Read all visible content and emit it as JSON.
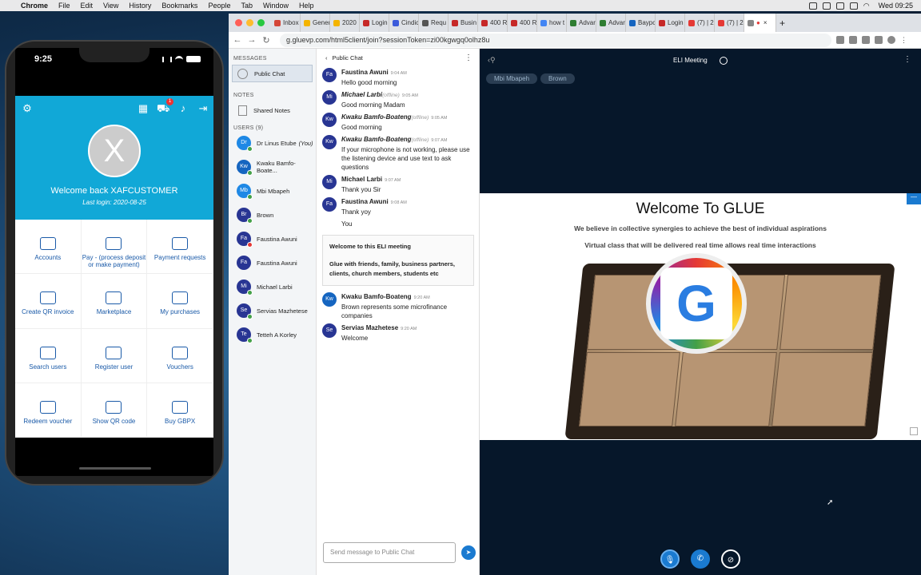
{
  "menubar": {
    "app": "Chrome",
    "items": [
      "File",
      "Edit",
      "View",
      "History",
      "Bookmarks",
      "People",
      "Tab",
      "Window",
      "Help"
    ],
    "clock": "Wed 09:25"
  },
  "phone": {
    "time": "9:25",
    "cart_badge": "1",
    "avatar_letter": "X",
    "welcome": "Welcome back XAFCUSTOMER",
    "last_login": "Last login: 2020-08-25",
    "grid": [
      "Accounts",
      "Pay - (process deposit or make payment)",
      "Payment requests",
      "Create QR invoice",
      "Marketplace",
      "My purchases",
      "Search users",
      "Register user",
      "Vouchers",
      "Redeem voucher",
      "Show QR code",
      "Buy GBPX"
    ]
  },
  "browser": {
    "tabs": [
      {
        "label": "Inbox",
        "color": "#d44638"
      },
      {
        "label": "Gener",
        "color": "#f4b400"
      },
      {
        "label": "2020",
        "color": "#f4b400"
      },
      {
        "label": "Login",
        "color": "#c62828"
      },
      {
        "label": "Cindic",
        "color": "#3b5bdb"
      },
      {
        "label": "Requ",
        "color": "#555"
      },
      {
        "label": "Busin",
        "color": "#c62828"
      },
      {
        "label": "400 R",
        "color": "#c62828"
      },
      {
        "label": "400 R",
        "color": "#c62828"
      },
      {
        "label": "how t",
        "color": "#4285f4"
      },
      {
        "label": "Advar",
        "color": "#2e7d32"
      },
      {
        "label": "Advar",
        "color": "#2e7d32"
      },
      {
        "label": "Baypc",
        "color": "#1565c0"
      },
      {
        "label": "Login",
        "color": "#c62828"
      },
      {
        "label": "(7) | 2",
        "color": "#e53935"
      },
      {
        "label": "(7) | 2",
        "color": "#e53935"
      }
    ],
    "url": "g.gluevp.com/html5client/join?sessionToken=zi00kgwgq0olhz8u"
  },
  "sidebar": {
    "messages_title": "MESSAGES",
    "public_chat": "Public Chat",
    "notes_title": "NOTES",
    "shared_notes": "Shared Notes",
    "users_title": "USERS (9)",
    "users": [
      {
        "initials": "Dr",
        "name": "Dr Linus Etube",
        "suffix": "(You)",
        "color": "#1e88e5",
        "status": "#43a047"
      },
      {
        "initials": "Kw",
        "name": "Kwaku Bamfo-Boate...",
        "suffix": "",
        "color": "#1565c0",
        "status": "#43a047"
      },
      {
        "initials": "Mb",
        "name": "Mbi Mbapeh",
        "suffix": "",
        "color": "#1e88e5",
        "status": "#43a047"
      },
      {
        "initials": "Br",
        "name": "Brown",
        "suffix": "",
        "color": "#283593",
        "status": "#43a047"
      },
      {
        "initials": "Fa",
        "name": "Faustina Awuni",
        "suffix": "",
        "color": "#283593",
        "status": "#e53935"
      },
      {
        "initials": "Fa",
        "name": "Faustina Awuni",
        "suffix": "",
        "color": "#283593",
        "status": ""
      },
      {
        "initials": "Mi",
        "name": "Michael Larbi",
        "suffix": "",
        "color": "#283593",
        "status": "#43a047"
      },
      {
        "initials": "Se",
        "name": "Servias Mazhetese",
        "suffix": "",
        "color": "#283593",
        "status": "#43a047"
      },
      {
        "initials": "Te",
        "name": "Tetteh A Korley",
        "suffix": "",
        "color": "#283593",
        "status": "#43a047"
      }
    ]
  },
  "chat": {
    "title": "Public Chat",
    "messages": [
      {
        "initials": "Fa",
        "name": "Faustina Awuni",
        "offline": "",
        "time": "9:04 AM",
        "lines": [
          "Hello good morning"
        ],
        "color": "#283593",
        "italic": false
      },
      {
        "initials": "Mi",
        "name": "Michael Larbi",
        "offline": "(offline)",
        "time": "9:05 AM",
        "lines": [
          "Good morning Madam"
        ],
        "color": "#283593",
        "italic": true
      },
      {
        "initials": "Kw",
        "name": "Kwaku Bamfo-Boateng",
        "offline": "(offline)",
        "time": "9:05 AM",
        "lines": [
          "Good morning"
        ],
        "color": "#283593",
        "italic": true
      },
      {
        "initials": "Kw",
        "name": "Kwaku Bamfo-Boateng",
        "offline": "(offline)",
        "time": "9:07 AM",
        "lines": [
          "If your microphone is not working, please use the listening device and use text to ask questions"
        ],
        "color": "#283593",
        "italic": true
      },
      {
        "initials": "Mi",
        "name": "Michael Larbi",
        "offline": "",
        "time": "9:07 AM",
        "lines": [
          "Thank you Sir"
        ],
        "color": "#283593",
        "italic": false
      },
      {
        "initials": "Fa",
        "name": "Faustina Awuni",
        "offline": "",
        "time": "9:08 AM",
        "lines": [
          "Thank yoy",
          "You"
        ],
        "color": "#283593",
        "italic": false
      }
    ],
    "welcome_title": "Welcome to this ELI meeting",
    "welcome_body": "Glue with friends, family, business partners, clients, church members, students etc",
    "messages2": [
      {
        "initials": "Kw",
        "name": "Kwaku Bamfo-Boateng",
        "offline": "",
        "time": "9:20 AM",
        "lines": [
          "Brown represents some microfinance companies"
        ],
        "color": "#1565c0",
        "italic": false
      },
      {
        "initials": "Se",
        "name": "Servias Mazhetese",
        "offline": "",
        "time": "9:20 AM",
        "lines": [
          "Welcome"
        ],
        "color": "#283593",
        "italic": false
      }
    ],
    "input_placeholder": "Send message to Public Chat"
  },
  "presentation": {
    "meeting_title": "ELI Meeting",
    "talkers": [
      "Mbi Mbapeh",
      "Brown"
    ],
    "slide_title": "Welcome To GLUE",
    "slide_line1": "We believe in collective synergies to achieve the best of individual aspirations",
    "slide_line2": "Virtual class that will be delivered real time allows real time interactions"
  }
}
